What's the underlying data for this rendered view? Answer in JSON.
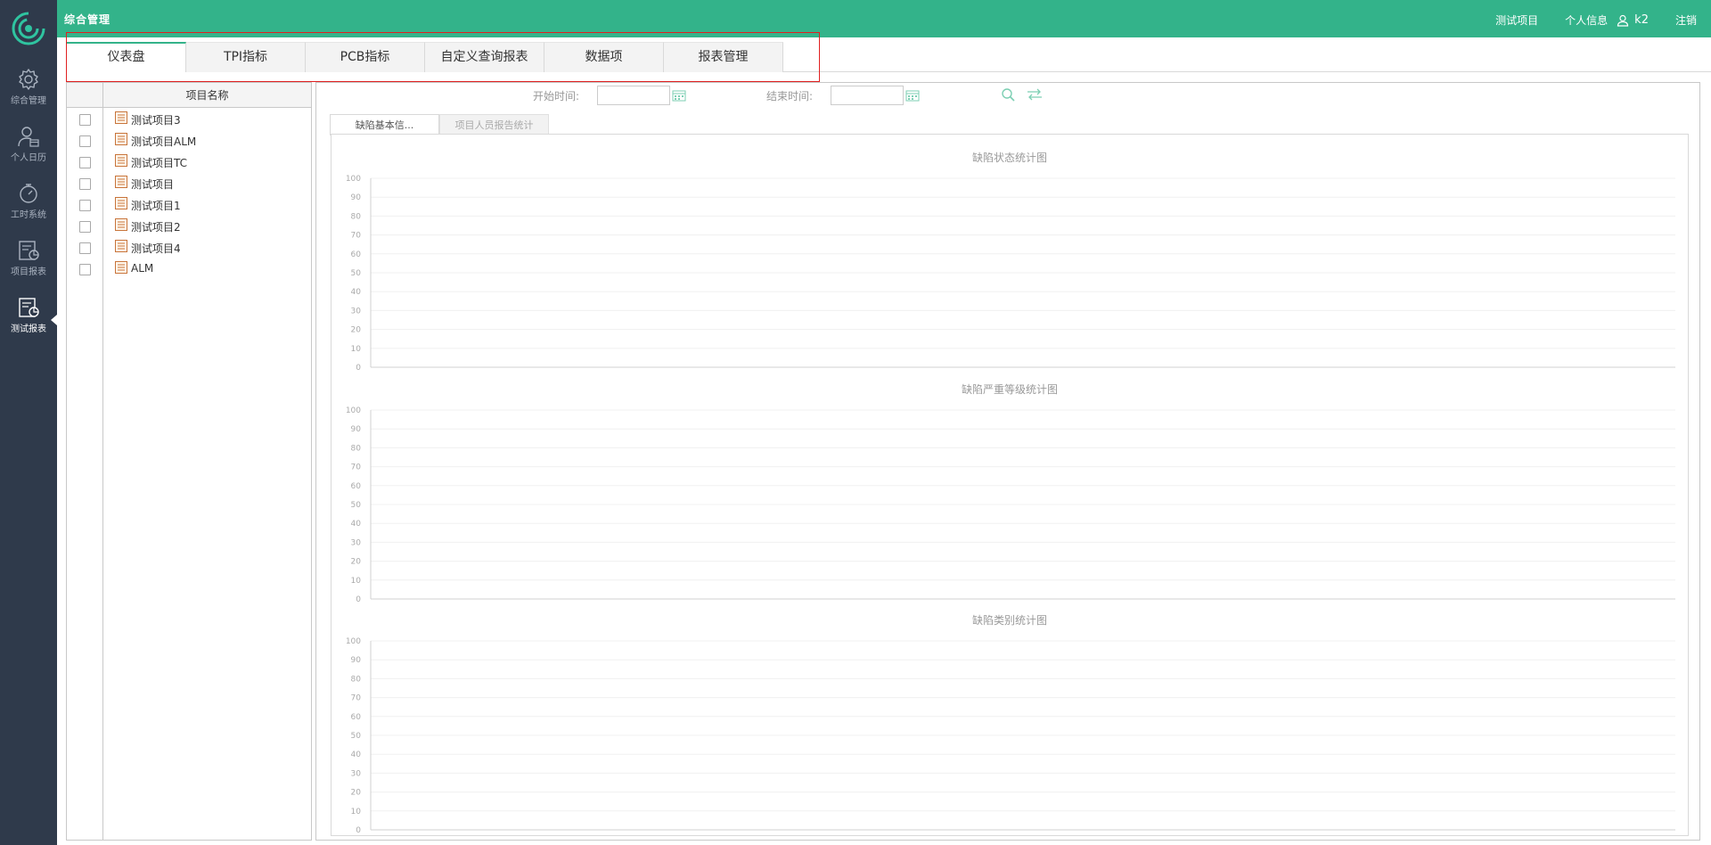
{
  "app": {
    "title": "综合管理",
    "colors": {
      "brand": "#33b38a",
      "sidebar": "#2f3a4b",
      "highlight": "#e02020"
    }
  },
  "header": {
    "project_link": "测试项目",
    "profile_link": "个人信息",
    "username": "k2",
    "logout": "注销",
    "user_icon": "user-icon"
  },
  "sidebar": {
    "logo_icon": "swirl-logo-icon",
    "items": [
      {
        "label": "综合管理",
        "icon": "gear-icon",
        "active": false
      },
      {
        "label": "个人日历",
        "icon": "user-calendar-icon",
        "active": false
      },
      {
        "label": "工时系统",
        "icon": "stopwatch-icon",
        "active": false
      },
      {
        "label": "项目报表",
        "icon": "report-chart-icon",
        "active": false
      },
      {
        "label": "测试报表",
        "icon": "test-report-icon",
        "active": true
      }
    ]
  },
  "tabs": [
    {
      "label": "仪表盘",
      "active": true
    },
    {
      "label": "TPI指标",
      "active": false
    },
    {
      "label": "PCB指标",
      "active": false
    },
    {
      "label": "自定义查询报表",
      "active": false
    },
    {
      "label": "数据项",
      "active": false
    },
    {
      "label": "报表管理",
      "active": false
    }
  ],
  "project_list": {
    "column_header": "项目名称",
    "items": [
      {
        "name": "测试项目3",
        "checked": false
      },
      {
        "name": "测试项目ALM",
        "checked": false
      },
      {
        "name": "测试项目TC",
        "checked": false
      },
      {
        "name": "测试项目",
        "checked": false
      },
      {
        "name": "测试项目1",
        "checked": false
      },
      {
        "name": "测试项目2",
        "checked": false
      },
      {
        "name": "测试项目4",
        "checked": false
      },
      {
        "name": "ALM",
        "checked": false
      }
    ]
  },
  "filters": {
    "start_label": "开始时间:",
    "start_value": "",
    "end_label": "结束时间:",
    "end_value": "",
    "search_icon": "search-icon",
    "reset_icon": "swap-arrows-icon",
    "calendar_icon": "calendar-icon"
  },
  "sub_tabs": [
    {
      "label": "缺陷基本信...",
      "active": true
    },
    {
      "label": "项目人员报告统计",
      "active": false
    }
  ],
  "chart_data": [
    {
      "type": "bar",
      "title": "缺陷状态统计图",
      "categories": [],
      "series": [],
      "ylim": [
        0,
        100
      ],
      "yticks": [
        0,
        10,
        20,
        30,
        40,
        50,
        60,
        70,
        80,
        90,
        100
      ],
      "grid": true
    },
    {
      "type": "bar",
      "title": "缺陷严重等级统计图",
      "categories": [],
      "series": [],
      "ylim": [
        0,
        100
      ],
      "yticks": [
        0,
        10,
        20,
        30,
        40,
        50,
        60,
        70,
        80,
        90,
        100
      ],
      "grid": true
    },
    {
      "type": "bar",
      "title": "缺陷类别统计图",
      "categories": [],
      "series": [],
      "ylim": [
        0,
        100
      ],
      "yticks": [
        0,
        10,
        20,
        30,
        40,
        50,
        60,
        70,
        80,
        90,
        100
      ],
      "grid": true
    }
  ]
}
